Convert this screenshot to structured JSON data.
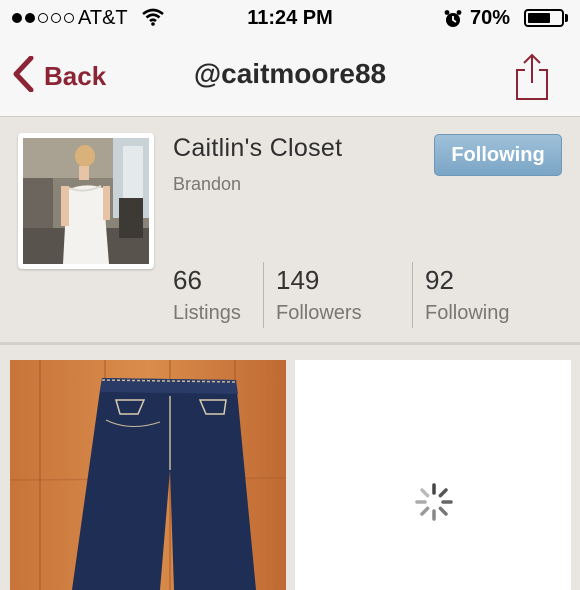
{
  "status_bar": {
    "carrier": "AT&T",
    "time": "11:24 PM",
    "battery_percent": "70%",
    "battery_level": 0.7
  },
  "nav": {
    "back_label": "Back",
    "title": "@caitmoore88"
  },
  "profile": {
    "closet_name": "Caitlin's Closet",
    "location": "Brandon",
    "follow_button_label": "Following",
    "stats": [
      {
        "value": "66",
        "label": "Listings"
      },
      {
        "value": "149",
        "label": "Followers"
      },
      {
        "value": "92",
        "label": "Following"
      }
    ]
  },
  "colors": {
    "accent": "#8b2434",
    "following_button": "#8fb4d1"
  }
}
